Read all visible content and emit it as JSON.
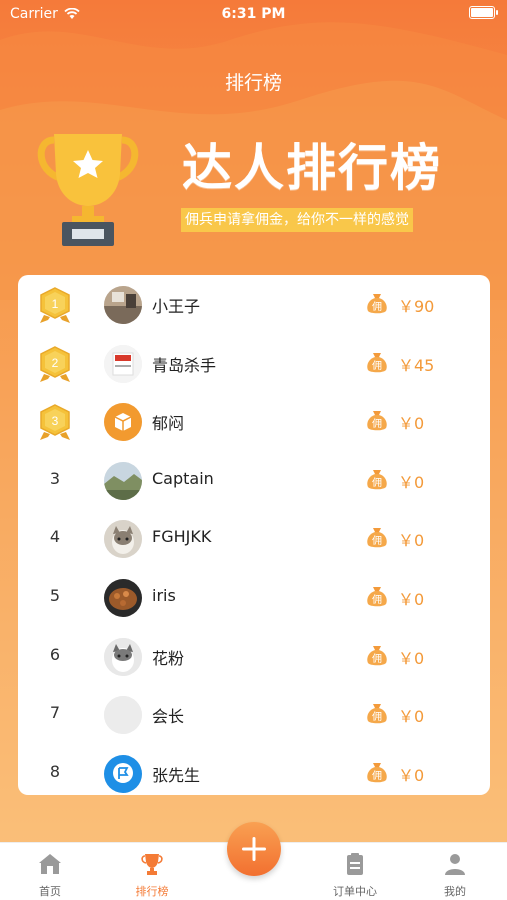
{
  "status_bar": {
    "carrier": "Carrier",
    "time": "6:31 PM"
  },
  "nav": {
    "title": "排行榜"
  },
  "hero": {
    "title": "达人排行榜",
    "subtitle": "佣兵申请拿佣金，给你不一样的感觉"
  },
  "ranking": {
    "coin_label": "佣",
    "rows": [
      {
        "rank": "1",
        "medal": true,
        "name": "小王子",
        "amount": "￥90",
        "avatar": "photo-room"
      },
      {
        "rank": "2",
        "medal": true,
        "name": "青岛杀手",
        "amount": "￥45",
        "avatar": "photo-box"
      },
      {
        "rank": "3",
        "medal": true,
        "name": "郁闷",
        "amount": "￥0",
        "avatar": "orange-icon"
      },
      {
        "rank": "3",
        "medal": false,
        "name": "Captain",
        "amount": "￥0",
        "avatar": "photo-landscape"
      },
      {
        "rank": "4",
        "medal": false,
        "name": "FGHJKK",
        "amount": "￥0",
        "avatar": "photo-cat"
      },
      {
        "rank": "5",
        "medal": false,
        "name": "iris",
        "amount": "￥0",
        "avatar": "photo-food"
      },
      {
        "rank": "6",
        "medal": false,
        "name": "花粉",
        "amount": "￥0",
        "avatar": "photo-cat2"
      },
      {
        "rank": "7",
        "medal": false,
        "name": "会长",
        "amount": "￥0",
        "avatar": "blank"
      },
      {
        "rank": "8",
        "medal": false,
        "name": "张先生",
        "amount": "￥0",
        "avatar": "blue-icon"
      }
    ]
  },
  "tabbar": {
    "home": "首页",
    "ranking": "排行榜",
    "orders": "订单中心",
    "mine": "我的"
  },
  "colors": {
    "accent": "#f47b36",
    "amount": "#f39a3a",
    "gold": "#f5c23a"
  }
}
